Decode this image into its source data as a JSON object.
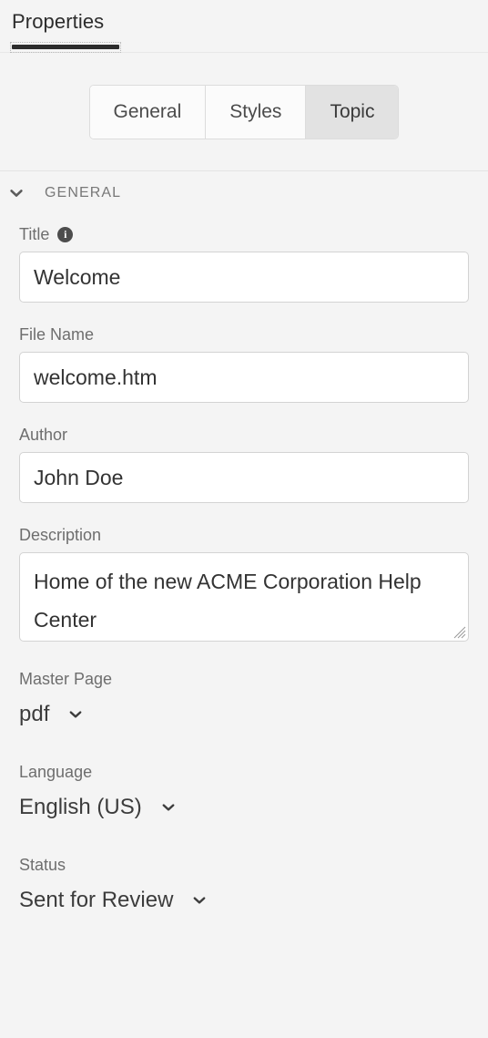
{
  "panel": {
    "tab_label": "Properties"
  },
  "segmented_control": {
    "options": [
      {
        "label": "General",
        "selected": false
      },
      {
        "label": "Styles",
        "selected": false
      },
      {
        "label": "Topic",
        "selected": true
      }
    ]
  },
  "section": {
    "title": "GENERAL",
    "expanded": true,
    "collapse_icon": "chevron-down-icon"
  },
  "fields": {
    "title": {
      "label": "Title",
      "value": "Welcome",
      "placeholder": "Title",
      "info_icon": "info-icon",
      "info_glyph": "i"
    },
    "file_name": {
      "label": "File Name",
      "value": "welcome.htm",
      "placeholder": "File Name"
    },
    "author": {
      "label": "Author",
      "value": "John Doe",
      "placeholder": "Author"
    },
    "description": {
      "label": "Description",
      "value": "Home of the new ACME Corporation Help Center",
      "placeholder": "Description",
      "resize_handle": "resize-grip-icon"
    },
    "master_page": {
      "label": "Master Page",
      "value": "pdf",
      "chevron_icon": "chevron-down-icon"
    },
    "language": {
      "label": "Language",
      "value": "English (US)",
      "chevron_icon": "chevron-down-icon"
    },
    "status": {
      "label": "Status",
      "value": "Sent for Review",
      "chevron_icon": "chevron-down-icon"
    }
  },
  "colors": {
    "background": "#f4f4f4",
    "input_background": "#ffffff",
    "input_border": "#d3d3d3",
    "text_primary": "#2c2c2c",
    "text_label": "#6e6e6e",
    "section_label": "#787878",
    "tab_underline": "#2c2c2c",
    "segment_selected": "#e2e2e2",
    "info_icon_fill": "#4d4d4d"
  }
}
